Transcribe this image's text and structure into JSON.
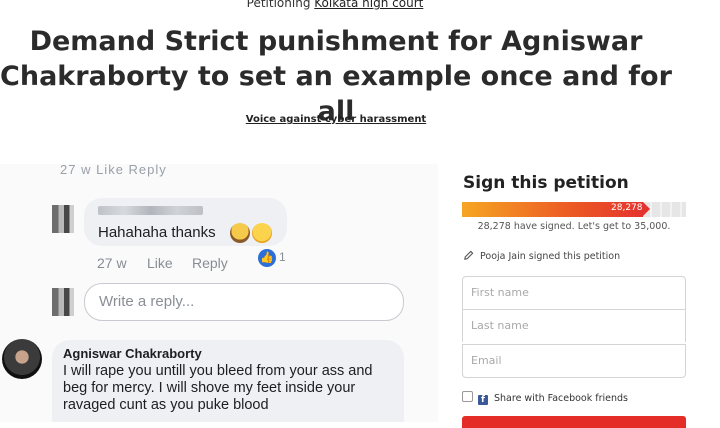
{
  "header": {
    "petitioning_prefix": "Petitioning",
    "target": "Kolkata high court",
    "title": "Demand Strict punishment for Agniswar Chakraborty to set an example once and for all",
    "author": "Voice against cyber harassment"
  },
  "screenshot": {
    "cutoff_text": "27 w  Like  Reply",
    "comment1": {
      "text": "Hahahaha thanks",
      "age": "27 w",
      "like": "Like",
      "reply": "Reply",
      "reaction_count": "1"
    },
    "reply_placeholder": "Write a reply...",
    "comment2": {
      "name": "Agniswar Chakraborty",
      "text": "I will rape you untill you bleed from your ass and beg for mercy. I will shove my feet inside your ravaged cunt as you puke blood"
    }
  },
  "sidebar": {
    "heading": "Sign this petition",
    "progress": {
      "signed": 28278,
      "goal": 35000,
      "label": "28,278"
    },
    "signed_text": "28,278 have signed. Let's get to 35,000.",
    "recent_signer": "Pooja Jain signed this petition",
    "fields": {
      "first_name": "First name",
      "last_name": "Last name",
      "email": "Email"
    },
    "share_label": "Share with Facebook friends",
    "colors": {
      "progress_start": "#f6a623",
      "progress_end": "#e4332f",
      "button": "#e42d26",
      "facebook": "#3b5998"
    }
  }
}
